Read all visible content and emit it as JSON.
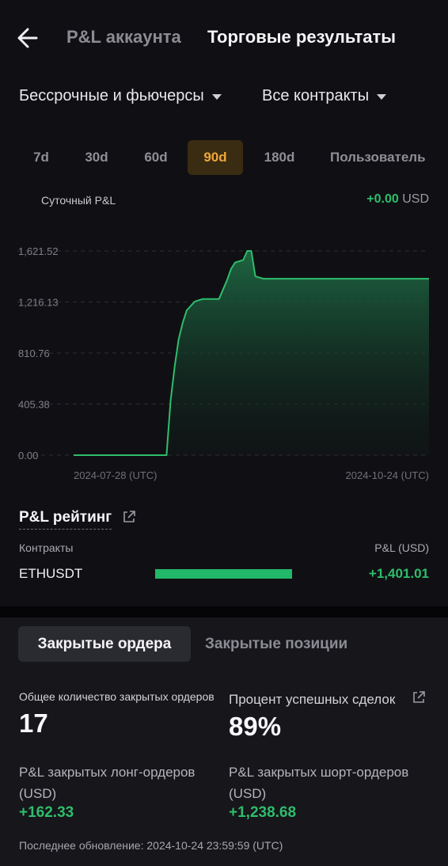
{
  "header": {
    "tab_pnl": "P&L аккаунта",
    "tab_results": "Торговые результаты"
  },
  "filters": {
    "product": "Бессрочные и фьючерсы",
    "contracts": "Все контракты"
  },
  "periods": [
    "7d",
    "30d",
    "60d",
    "90d",
    "180d",
    "Пользователь"
  ],
  "active_period": "90d",
  "daily_pnl": {
    "label": "Суточный P&L",
    "value": "+0.00",
    "unit": "USD"
  },
  "chart_data": {
    "type": "area",
    "y_ticks": [
      "1,621.52",
      "1,216.13",
      "810.76",
      "405.38",
      "0.00"
    ],
    "y_tick_values": [
      1621.52,
      1216.13,
      810.76,
      405.38,
      0
    ],
    "ylim": [
      0,
      1621.52
    ],
    "x_start_label": "2024-07-28 (UTC)",
    "x_end_label": "2024-10-24 (UTC)",
    "x": [
      "2024-07-28",
      "2024-08-05",
      "2024-08-13",
      "2024-08-20",
      "2024-08-21",
      "2024-08-22",
      "2024-08-23",
      "2024-08-24",
      "2024-08-25",
      "2024-08-27",
      "2024-08-29",
      "2024-08-31",
      "2024-09-02",
      "2024-09-04",
      "2024-09-05",
      "2024-09-06",
      "2024-09-08",
      "2024-09-09",
      "2024-09-10",
      "2024-09-11",
      "2024-09-13",
      "2024-09-16",
      "2024-09-24",
      "2024-10-04",
      "2024-10-14",
      "2024-10-24"
    ],
    "values": [
      0,
      0,
      0,
      0,
      430,
      700,
      920,
      1050,
      1150,
      1220,
      1240,
      1240,
      1240,
      1390,
      1480,
      1530,
      1550,
      1621.52,
      1621.52,
      1420,
      1401.01,
      1401.01,
      1401.01,
      1401.01,
      1401.01,
      1401.01
    ],
    "colors": {
      "line": "#2ebd6b",
      "fill_top": "#1f6a45"
    },
    "grid": true
  },
  "ranking": {
    "title": "P&L рейтинг",
    "col_contracts": "Контракты",
    "col_pnl": "P&L (USD)",
    "rows": [
      {
        "symbol": "ETHUSDT",
        "value": "+1,401.01",
        "share": 1.0
      }
    ]
  },
  "bottom_tabs": {
    "orders": "Закрытые ордера",
    "positions": "Закрытые позиции"
  },
  "stats": {
    "total_label": "Общее количество закрытых ордеров",
    "total_value": "17",
    "winrate_label": "Процент успешных сделок",
    "winrate_value": "89%",
    "long_label_line1": "P&L закрытых лонг-ордеров",
    "long_label_line2": "(USD)",
    "long_value": "+162.33",
    "short_label_line1": "P&L закрытых шорт-ордеров",
    "short_label_line2": "(USD)",
    "short_value": "+1,238.68"
  },
  "updated": "Последнее обновление: 2024-10-24 23:59:59 (UTC)"
}
